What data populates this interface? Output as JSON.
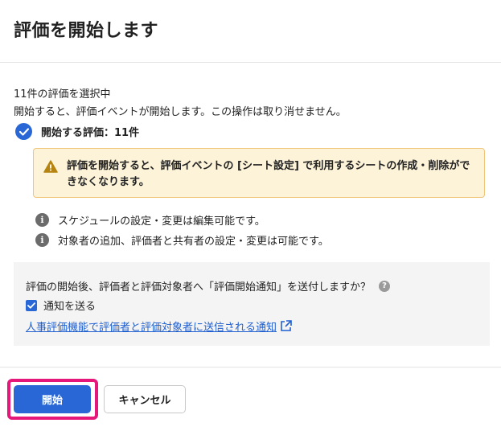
{
  "dialog": {
    "title": "評価を開始します"
  },
  "summary": {
    "selected_count": "11件の評価を選択中",
    "notice": "開始すると、評価イベントが開始します。この操作は取り消せません。",
    "start_count_label": "開始する評価：11件"
  },
  "warning": {
    "text": "評価を開始すると、評価イベントの [シート設定] で利用するシートの作成・削除ができなくなります。"
  },
  "info": {
    "items": [
      "スケジュールの設定・変更は編集可能です。",
      "対象者の追加、評価者と共有者の設定・変更は可能です。"
    ]
  },
  "notification": {
    "question": "評価の開始後、評価者と評価対象者へ「評価開始通知」を送付しますか？",
    "checkbox_label": "通知を送る",
    "checkbox_checked": true,
    "link_text": "人事評価機能で評価者と評価対象者に送信される通知"
  },
  "footer": {
    "start_label": "開始",
    "cancel_label": "キャンセル"
  },
  "colors": {
    "primary": "#2a67d6",
    "warning_bg": "#fdf3d8",
    "warning_border": "#efc57a",
    "highlight": "#e5177b",
    "link": "#1f5fd0"
  }
}
